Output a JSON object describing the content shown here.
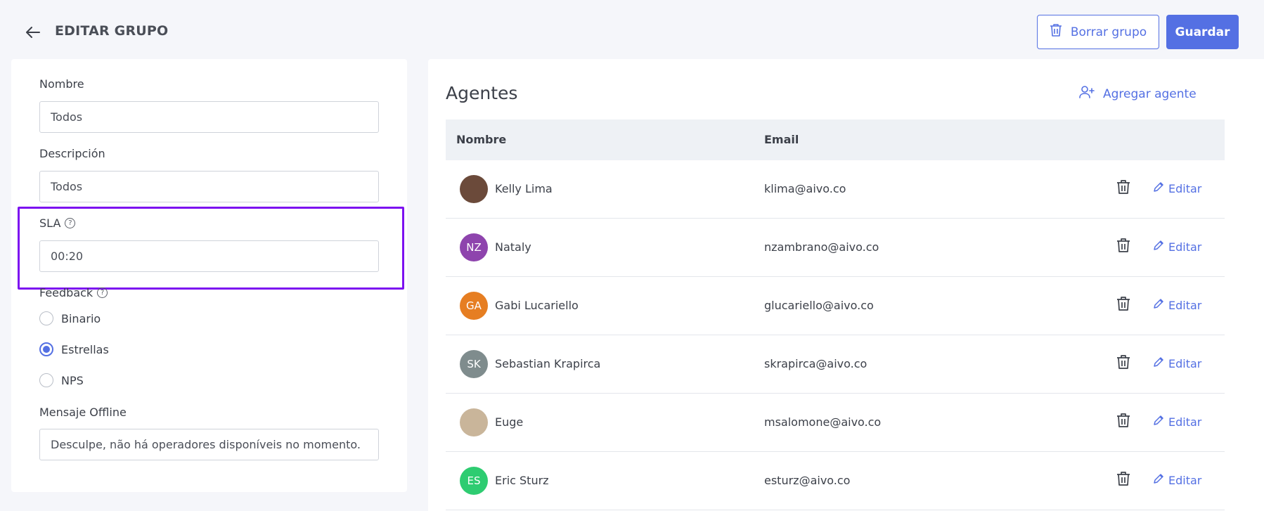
{
  "header": {
    "title": "EDITAR GRUPO",
    "delete_label": "Borrar grupo",
    "save_label": "Guardar"
  },
  "form": {
    "name_label": "Nombre",
    "name_value": "Todos",
    "description_label": "Descripción",
    "description_value": "Todos",
    "sla_label": "SLA",
    "sla_value": "00:20",
    "feedback_label": "Feedback",
    "feedback_options": [
      {
        "label": "Binario",
        "selected": false
      },
      {
        "label": "Estrellas",
        "selected": true
      },
      {
        "label": "NPS",
        "selected": false
      }
    ],
    "offline_label": "Mensaje Offline",
    "offline_value": "Desculpe, não há operadores disponíveis no momento."
  },
  "agents": {
    "title": "Agentes",
    "add_label": "Agregar agente",
    "columns": {
      "name": "Nombre",
      "email": "Email"
    },
    "edit_label": "Editar",
    "rows": [
      {
        "name": "Kelly Lima",
        "email": "klima@aivo.co",
        "initials": "",
        "color": "#6b4a3a"
      },
      {
        "name": "Nataly",
        "email": "nzambrano@aivo.co",
        "initials": "NZ",
        "color": "#8e44ad"
      },
      {
        "name": "Gabi Lucariello",
        "email": "glucariello@aivo.co",
        "initials": "GA",
        "color": "#e67e22"
      },
      {
        "name": "Sebastian Krapirca",
        "email": "skrapirca@aivo.co",
        "initials": "SK",
        "color": "#7f8c8d"
      },
      {
        "name": "Euge",
        "email": "msalomone@aivo.co",
        "initials": "",
        "color": "#c9b59a"
      },
      {
        "name": "Eric Sturz",
        "email": "esturz@aivo.co",
        "initials": "ES",
        "color": "#2ecc71"
      }
    ]
  },
  "colors": {
    "accent": "#5470e3",
    "highlight": "#7c11f0"
  }
}
